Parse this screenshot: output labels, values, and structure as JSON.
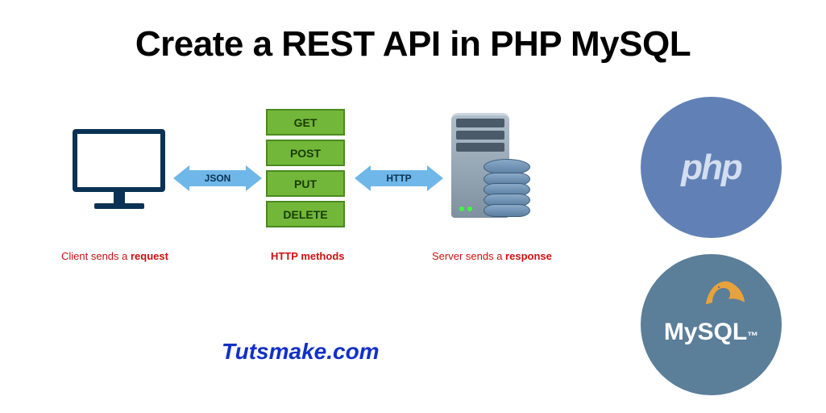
{
  "title": "Create a REST API in PHP MySQL",
  "diagram": {
    "arrow_left_label": "JSON",
    "arrow_right_label": "HTTP",
    "methods": [
      "GET",
      "POST",
      "PUT",
      "DELETE"
    ],
    "caption_client_prefix": "Client sends a ",
    "caption_client_bold": "request",
    "caption_methods": "HTTP methods",
    "caption_server_prefix": "Server sends a ",
    "caption_server_bold": "response"
  },
  "brand": "Tutsmake.com",
  "logos": {
    "php": "php",
    "mysql_text": "MySQL",
    "mysql_suffix": "™"
  },
  "colors": {
    "title": "#000000",
    "arrow": "#6fb7e8",
    "method_bg": "#73b73a",
    "caption": "#cc1111",
    "brand": "#1130c8",
    "php_bg": "#6181b6",
    "mysql_bg": "#5b7e99"
  }
}
